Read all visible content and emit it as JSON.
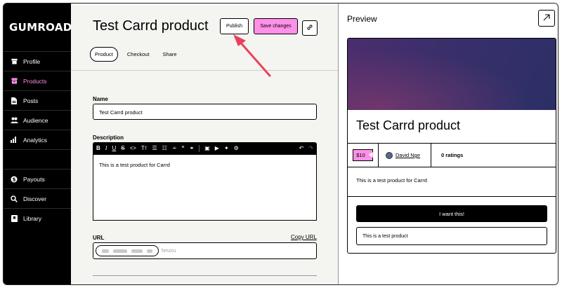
{
  "app": {
    "logo": "GUMROAD"
  },
  "sidebar": {
    "items": [
      {
        "label": "Profile",
        "icon": "store-icon"
      },
      {
        "label": "Products",
        "icon": "archive-icon",
        "active": true
      },
      {
        "label": "Posts",
        "icon": "document-icon"
      },
      {
        "label": "Audience",
        "icon": "people-icon"
      },
      {
        "label": "Analytics",
        "icon": "bar-chart-icon"
      },
      {
        "label": "Payouts",
        "icon": "dollar-circle-icon"
      },
      {
        "label": "Discover",
        "icon": "search-icon"
      },
      {
        "label": "Library",
        "icon": "bookmark-icon"
      }
    ],
    "active_color": "#ff90e8"
  },
  "header": {
    "title": "Test Carrd product",
    "publish_label": "Publish",
    "save_label": "Save changes",
    "tabs": [
      {
        "label": "Product",
        "active": true
      },
      {
        "label": "Checkout"
      },
      {
        "label": "Share"
      }
    ]
  },
  "form": {
    "name_label": "Name",
    "name_value": "Test Carrd product",
    "description_label": "Description",
    "description_value": "This is a test product for Carrd",
    "url_label": "URL",
    "copy_url_label": "Copy URL",
    "url_suffix": "hmzcu"
  },
  "preview": {
    "title": "Preview",
    "product_title": "Test Carrd product",
    "price": "$10",
    "creator": "David Nge",
    "ratings": "0 ratings",
    "description": "This is a test product for Carrd",
    "cta_label": "I want this!",
    "summary": "This is a test product"
  },
  "colors": {
    "accent_pink": "#ff90e8",
    "annotation_arrow": "#e8425a",
    "sidebar_bg": "#000000"
  }
}
